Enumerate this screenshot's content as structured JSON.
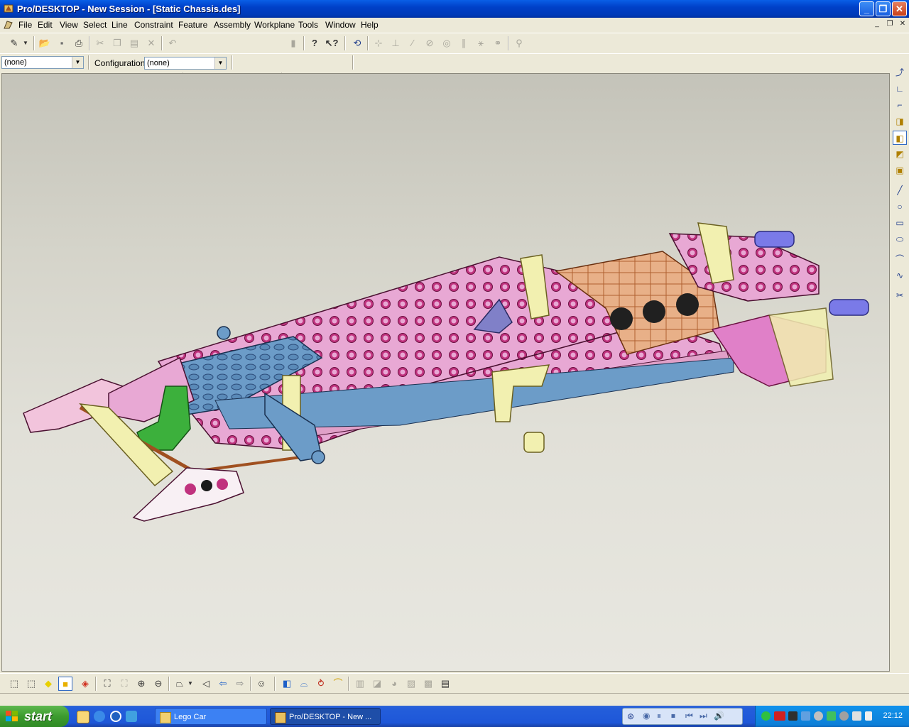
{
  "window": {
    "title": "Pro/DESKTOP - New Session - [Static Chassis.des]",
    "controls": {
      "minimize": "_",
      "restore": "❐",
      "close": "✕"
    }
  },
  "menu": {
    "items": [
      "File",
      "Edit",
      "View",
      "Select",
      "Line",
      "Constraint",
      "Feature",
      "Assembly",
      "Workplane",
      "Tools",
      "Window",
      "Help"
    ]
  },
  "toolbar2": {
    "combo1_value": "(none)",
    "configuration_label": "Configuration:",
    "configuration_value": "(none)"
  },
  "taskbar": {
    "start_label": "start",
    "tasks": [
      "Lego Car",
      "Pro/DESKTOP - New ..."
    ],
    "clock": "22:12"
  },
  "colors": {
    "pink": "#e8a8d4",
    "blue": "#6c9cc8",
    "yellow": "#f2f0b0",
    "green": "#3cb03c",
    "copper": "#e8b088",
    "magenta": "#cc2288",
    "purple": "#7a7ae8"
  },
  "icons": {
    "toolbar1": [
      "snap-icon",
      "open-icon",
      "save-icon",
      "print-icon",
      "cut-icon",
      "copy-icon",
      "paste-icon",
      "delete-icon",
      "undo-icon",
      "glue-icon",
      "help-icon",
      "whats-this-icon",
      "sketch-dimension-icon",
      "constraint-icon",
      "perpendicular-icon",
      "parallel-icon",
      "tangent-icon",
      "concentric-icon",
      "equal-icon",
      "symmetric-icon",
      "coincident-icon",
      "analyze-icon"
    ],
    "right": [
      "select-icon",
      "line-select-icon",
      "edge-select-icon",
      "face-select-icon",
      "part-select-icon",
      "feature-select-icon",
      "workplane-select-icon",
      "line-icon",
      "circle-icon",
      "rectangle-icon",
      "ellipse-icon",
      "arc-icon",
      "spline-icon",
      "trim-icon"
    ],
    "bottom": [
      "isometric-view-icon",
      "wireframe-icon",
      "shaded-icon",
      "enhanced-icon",
      "realistic-icon",
      "fit-icon",
      "zoom-window-icon",
      "zoom-in-icon",
      "zoom-out-icon",
      "workplane-view-icon",
      "previous-view-icon",
      "back-icon",
      "forward-icon",
      "smiley-icon",
      "extrude-icon",
      "revolve-icon",
      "sweep-icon",
      "loft-icon",
      "shell-icon",
      "chamfer-icon",
      "fillet-icon",
      "draft-icon",
      "pattern-icon",
      "thread-icon"
    ]
  }
}
